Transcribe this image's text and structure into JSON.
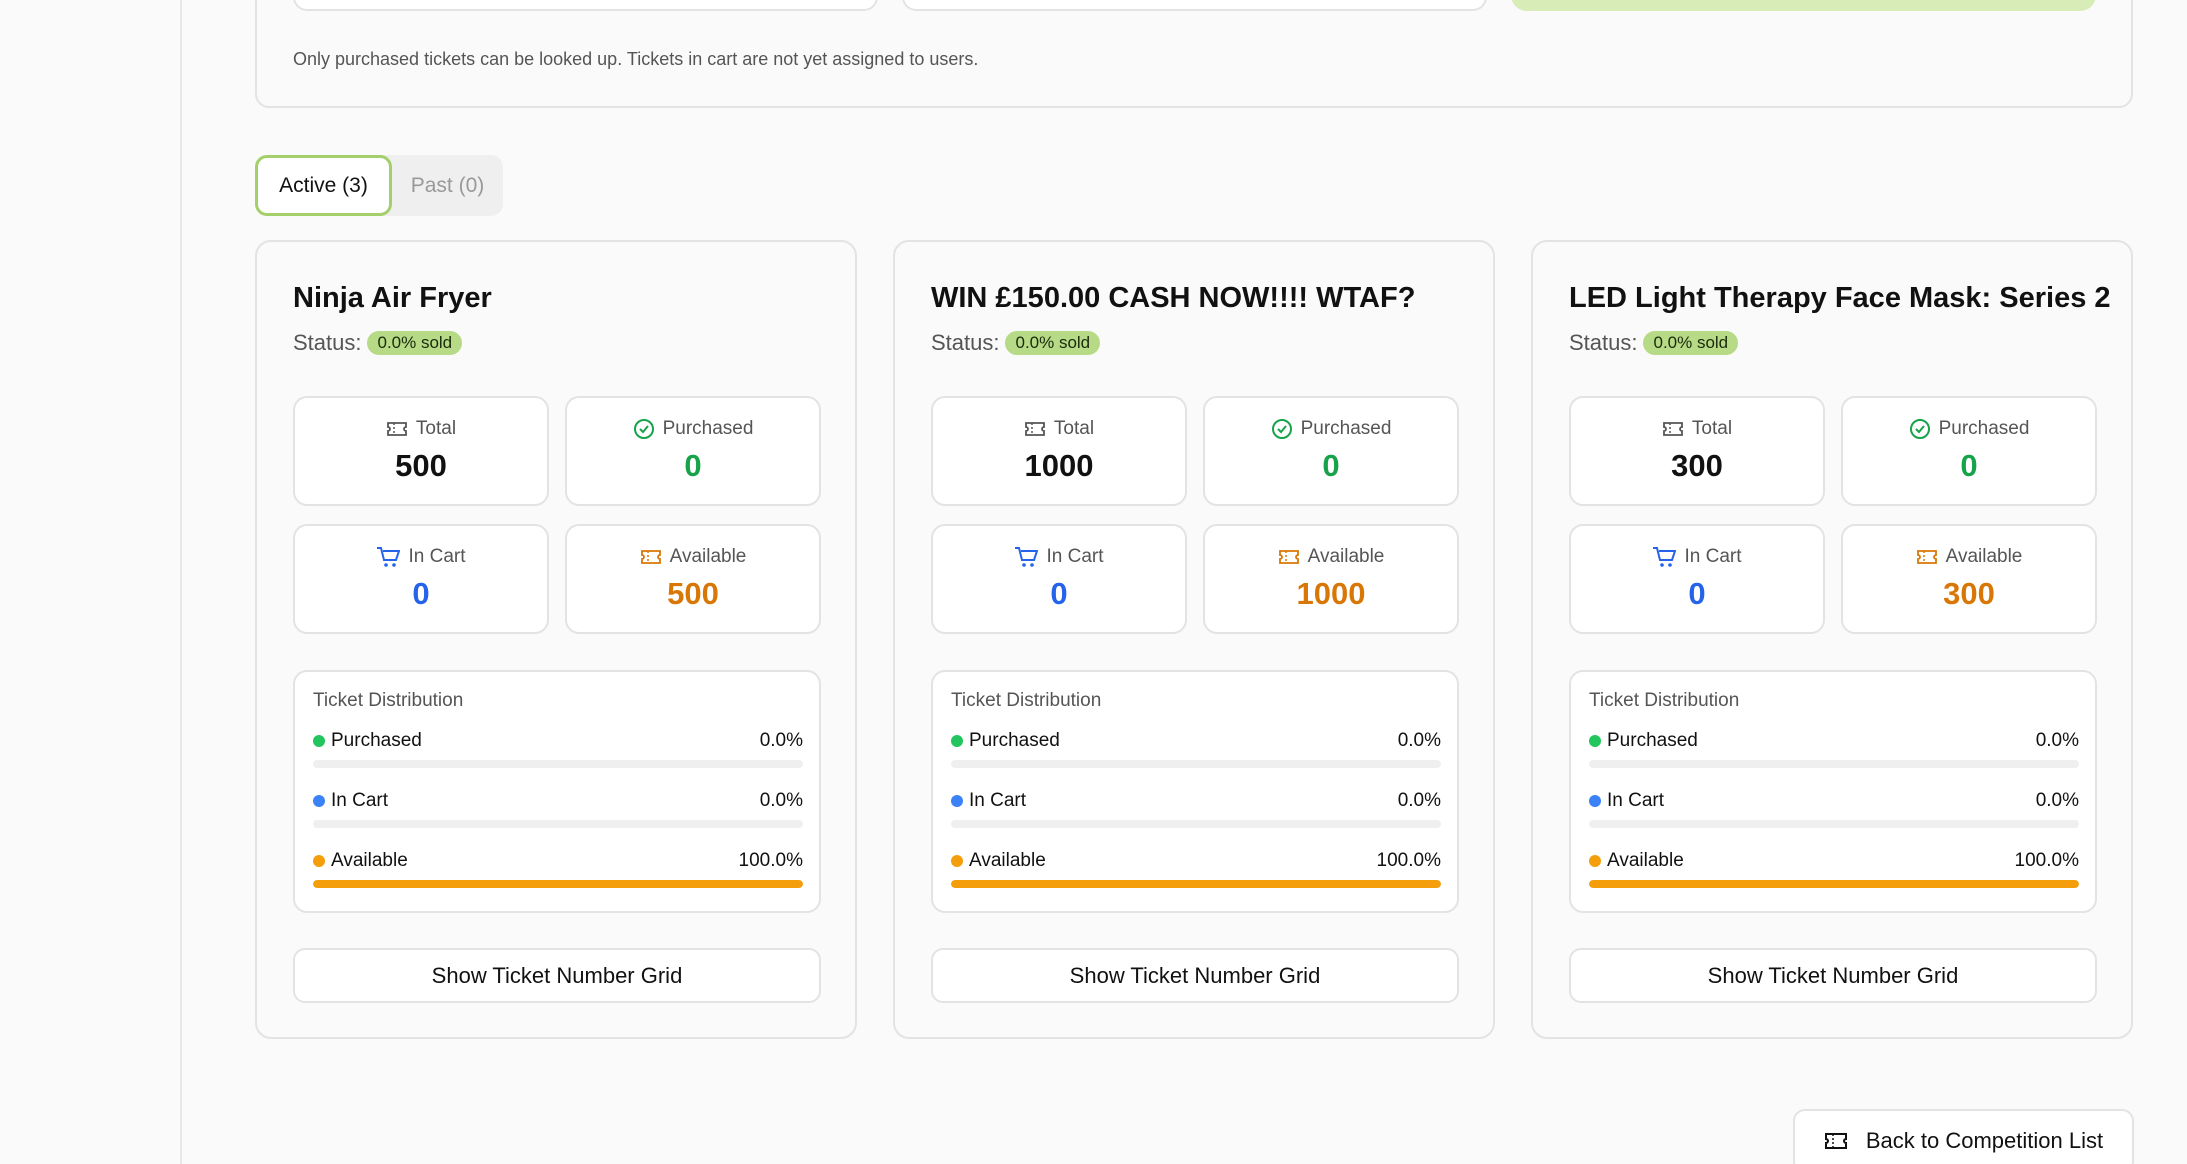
{
  "lookup": {
    "note": "Only purchased tickets can be looked up. Tickets in cart are not yet assigned to users."
  },
  "tabs": [
    {
      "label": "Active (3)",
      "active": true
    },
    {
      "label": "Past (0)",
      "active": false
    }
  ],
  "labels": {
    "status": "Status:",
    "total": "Total",
    "purchased": "Purchased",
    "in_cart": "In Cart",
    "available": "Available",
    "distribution_title": "Ticket Distribution",
    "grid_button": "Show Ticket Number Grid"
  },
  "colors": {
    "accent": "#a4cf6a",
    "purchased": "#22c55e",
    "in_cart": "#3b82f6",
    "available": "#f59e0b"
  },
  "competitions": [
    {
      "title": "Ninja Air Fryer",
      "status_badge": "0.0% sold",
      "total": "500",
      "purchased": "0",
      "in_cart": "0",
      "available": "500",
      "distribution": {
        "purchased_pct": "0.0%",
        "in_cart_pct": "0.0%",
        "available_pct": "100.0%",
        "purchased_fraction": 0,
        "in_cart_fraction": 0,
        "available_fraction": 1
      }
    },
    {
      "title": "WIN £150.00 CASH NOW!!!! WTAF?",
      "status_badge": "0.0% sold",
      "total": "1000",
      "purchased": "0",
      "in_cart": "0",
      "available": "1000",
      "distribution": {
        "purchased_pct": "0.0%",
        "in_cart_pct": "0.0%",
        "available_pct": "100.0%",
        "purchased_fraction": 0,
        "in_cart_fraction": 0,
        "available_fraction": 1
      }
    },
    {
      "title": "LED Light Therapy Face Mask: Series 2",
      "status_badge": "0.0% sold",
      "total": "300",
      "purchased": "0",
      "in_cart": "0",
      "available": "300",
      "distribution": {
        "purchased_pct": "0.0%",
        "in_cart_pct": "0.0%",
        "available_pct": "100.0%",
        "purchased_fraction": 0,
        "in_cart_fraction": 0,
        "available_fraction": 1
      }
    }
  ],
  "back_button": {
    "label": "Back to Competition List",
    "icon": "ticket-icon"
  }
}
